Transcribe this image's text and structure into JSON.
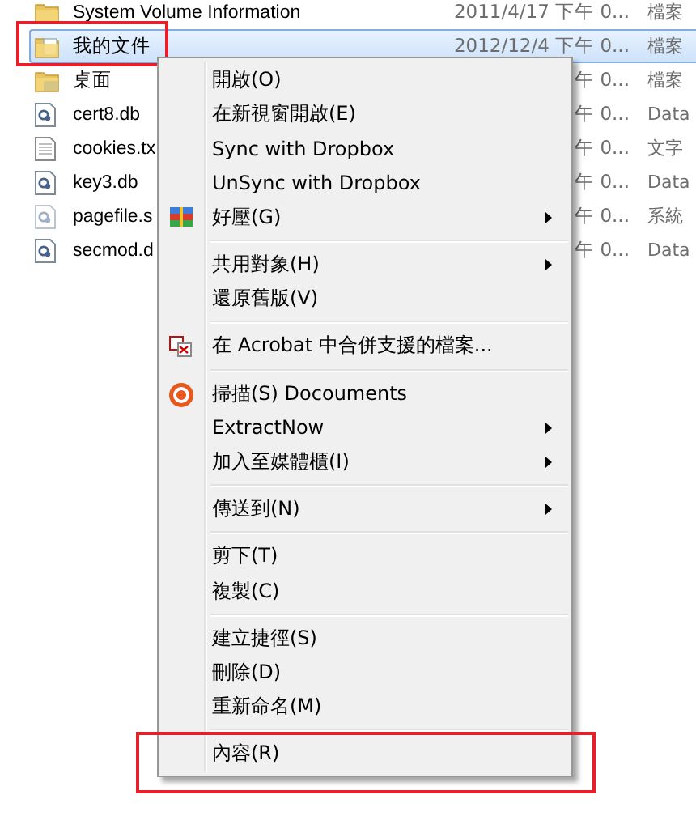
{
  "file_list": {
    "rows": [
      {
        "kind": "folder",
        "name": "System Volume Information",
        "date": "2011/4/17 下午 0...",
        "type": "檔案",
        "selected": false
      },
      {
        "kind": "doc-folder",
        "name": "我的文件",
        "date": "2012/12/4 下午 0...",
        "type": "檔案",
        "selected": true
      },
      {
        "kind": "desktop-folder",
        "name": "桌面",
        "date": "午 0...",
        "type": "檔案",
        "selected": false
      },
      {
        "kind": "db-file",
        "name": "cert8.db",
        "date": "午 0...",
        "type": "Data",
        "selected": false
      },
      {
        "kind": "text-file",
        "name": "cookies.tx",
        "date": "午 0...",
        "type": "文字",
        "selected": false
      },
      {
        "kind": "db-file",
        "name": "key3.db",
        "date": "午 0...",
        "type": "Data",
        "selected": false
      },
      {
        "kind": "system-file",
        "name": "pagefile.s",
        "date": "午 0...",
        "type": "系統",
        "selected": false
      },
      {
        "kind": "db-file",
        "name": "secmod.d",
        "date": "午 0...",
        "type": "Data",
        "selected": false
      }
    ]
  },
  "context_menu": {
    "items": [
      {
        "kind": "plain",
        "label": "開啟(O)"
      },
      {
        "kind": "plain",
        "label": "在新視窗開啟(E)"
      },
      {
        "kind": "plain",
        "label": "Sync with Dropbox"
      },
      {
        "kind": "plain",
        "label": "UnSync with Dropbox"
      },
      {
        "kind": "archive",
        "label": "好壓(G)",
        "submenu": true
      },
      {
        "kind": "separator"
      },
      {
        "kind": "plain",
        "label": "共用對象(H)",
        "submenu": true
      },
      {
        "kind": "plain",
        "label": "還原舊版(V)"
      },
      {
        "kind": "separator"
      },
      {
        "kind": "acrobat",
        "label": "在 Acrobat 中合併支援的檔案..."
      },
      {
        "kind": "separator"
      },
      {
        "kind": "scan",
        "label": "掃描(S) Docouments"
      },
      {
        "kind": "plain",
        "label": "ExtractNow",
        "submenu": true
      },
      {
        "kind": "plain",
        "label": "加入至媒體櫃(I)",
        "submenu": true
      },
      {
        "kind": "separator"
      },
      {
        "kind": "plain",
        "label": "傳送到(N)",
        "submenu": true
      },
      {
        "kind": "separator"
      },
      {
        "kind": "plain",
        "label": "剪下(T)"
      },
      {
        "kind": "plain",
        "label": "複製(C)"
      },
      {
        "kind": "separator"
      },
      {
        "kind": "plain",
        "label": "建立捷徑(S)"
      },
      {
        "kind": "plain",
        "label": "刪除(D)"
      },
      {
        "kind": "plain",
        "label": "重新命名(M)"
      },
      {
        "kind": "separator"
      },
      {
        "kind": "plain",
        "label": "內容(R)"
      }
    ]
  }
}
